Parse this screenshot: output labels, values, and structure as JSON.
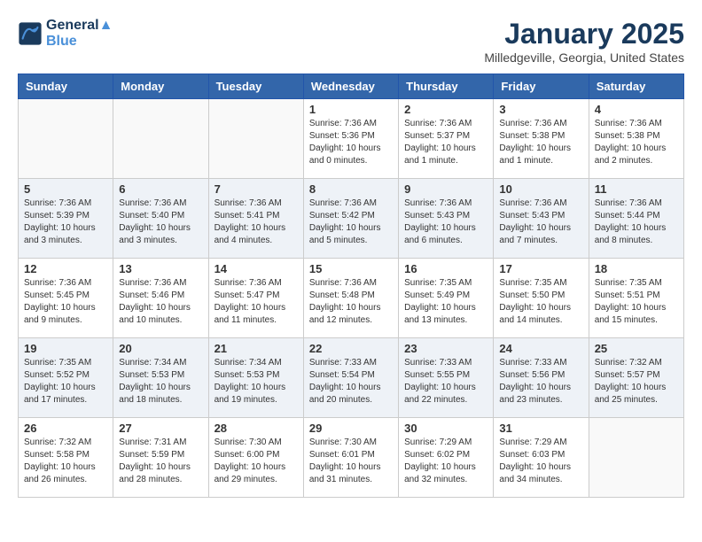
{
  "header": {
    "logo_line1": "General",
    "logo_line2": "Blue",
    "month_title": "January 2025",
    "location": "Milledgeville, Georgia, United States"
  },
  "weekdays": [
    "Sunday",
    "Monday",
    "Tuesday",
    "Wednesday",
    "Thursday",
    "Friday",
    "Saturday"
  ],
  "weeks": [
    [
      {
        "day": "",
        "info": ""
      },
      {
        "day": "",
        "info": ""
      },
      {
        "day": "",
        "info": ""
      },
      {
        "day": "1",
        "info": "Sunrise: 7:36 AM\nSunset: 5:36 PM\nDaylight: 10 hours\nand 0 minutes."
      },
      {
        "day": "2",
        "info": "Sunrise: 7:36 AM\nSunset: 5:37 PM\nDaylight: 10 hours\nand 1 minute."
      },
      {
        "day": "3",
        "info": "Sunrise: 7:36 AM\nSunset: 5:38 PM\nDaylight: 10 hours\nand 1 minute."
      },
      {
        "day": "4",
        "info": "Sunrise: 7:36 AM\nSunset: 5:38 PM\nDaylight: 10 hours\nand 2 minutes."
      }
    ],
    [
      {
        "day": "5",
        "info": "Sunrise: 7:36 AM\nSunset: 5:39 PM\nDaylight: 10 hours\nand 3 minutes."
      },
      {
        "day": "6",
        "info": "Sunrise: 7:36 AM\nSunset: 5:40 PM\nDaylight: 10 hours\nand 3 minutes."
      },
      {
        "day": "7",
        "info": "Sunrise: 7:36 AM\nSunset: 5:41 PM\nDaylight: 10 hours\nand 4 minutes."
      },
      {
        "day": "8",
        "info": "Sunrise: 7:36 AM\nSunset: 5:42 PM\nDaylight: 10 hours\nand 5 minutes."
      },
      {
        "day": "9",
        "info": "Sunrise: 7:36 AM\nSunset: 5:43 PM\nDaylight: 10 hours\nand 6 minutes."
      },
      {
        "day": "10",
        "info": "Sunrise: 7:36 AM\nSunset: 5:43 PM\nDaylight: 10 hours\nand 7 minutes."
      },
      {
        "day": "11",
        "info": "Sunrise: 7:36 AM\nSunset: 5:44 PM\nDaylight: 10 hours\nand 8 minutes."
      }
    ],
    [
      {
        "day": "12",
        "info": "Sunrise: 7:36 AM\nSunset: 5:45 PM\nDaylight: 10 hours\nand 9 minutes."
      },
      {
        "day": "13",
        "info": "Sunrise: 7:36 AM\nSunset: 5:46 PM\nDaylight: 10 hours\nand 10 minutes."
      },
      {
        "day": "14",
        "info": "Sunrise: 7:36 AM\nSunset: 5:47 PM\nDaylight: 10 hours\nand 11 minutes."
      },
      {
        "day": "15",
        "info": "Sunrise: 7:36 AM\nSunset: 5:48 PM\nDaylight: 10 hours\nand 12 minutes."
      },
      {
        "day": "16",
        "info": "Sunrise: 7:35 AM\nSunset: 5:49 PM\nDaylight: 10 hours\nand 13 minutes."
      },
      {
        "day": "17",
        "info": "Sunrise: 7:35 AM\nSunset: 5:50 PM\nDaylight: 10 hours\nand 14 minutes."
      },
      {
        "day": "18",
        "info": "Sunrise: 7:35 AM\nSunset: 5:51 PM\nDaylight: 10 hours\nand 15 minutes."
      }
    ],
    [
      {
        "day": "19",
        "info": "Sunrise: 7:35 AM\nSunset: 5:52 PM\nDaylight: 10 hours\nand 17 minutes."
      },
      {
        "day": "20",
        "info": "Sunrise: 7:34 AM\nSunset: 5:53 PM\nDaylight: 10 hours\nand 18 minutes."
      },
      {
        "day": "21",
        "info": "Sunrise: 7:34 AM\nSunset: 5:53 PM\nDaylight: 10 hours\nand 19 minutes."
      },
      {
        "day": "22",
        "info": "Sunrise: 7:33 AM\nSunset: 5:54 PM\nDaylight: 10 hours\nand 20 minutes."
      },
      {
        "day": "23",
        "info": "Sunrise: 7:33 AM\nSunset: 5:55 PM\nDaylight: 10 hours\nand 22 minutes."
      },
      {
        "day": "24",
        "info": "Sunrise: 7:33 AM\nSunset: 5:56 PM\nDaylight: 10 hours\nand 23 minutes."
      },
      {
        "day": "25",
        "info": "Sunrise: 7:32 AM\nSunset: 5:57 PM\nDaylight: 10 hours\nand 25 minutes."
      }
    ],
    [
      {
        "day": "26",
        "info": "Sunrise: 7:32 AM\nSunset: 5:58 PM\nDaylight: 10 hours\nand 26 minutes."
      },
      {
        "day": "27",
        "info": "Sunrise: 7:31 AM\nSunset: 5:59 PM\nDaylight: 10 hours\nand 28 minutes."
      },
      {
        "day": "28",
        "info": "Sunrise: 7:30 AM\nSunset: 6:00 PM\nDaylight: 10 hours\nand 29 minutes."
      },
      {
        "day": "29",
        "info": "Sunrise: 7:30 AM\nSunset: 6:01 PM\nDaylight: 10 hours\nand 31 minutes."
      },
      {
        "day": "30",
        "info": "Sunrise: 7:29 AM\nSunset: 6:02 PM\nDaylight: 10 hours\nand 32 minutes."
      },
      {
        "day": "31",
        "info": "Sunrise: 7:29 AM\nSunset: 6:03 PM\nDaylight: 10 hours\nand 34 minutes."
      },
      {
        "day": "",
        "info": ""
      }
    ]
  ]
}
